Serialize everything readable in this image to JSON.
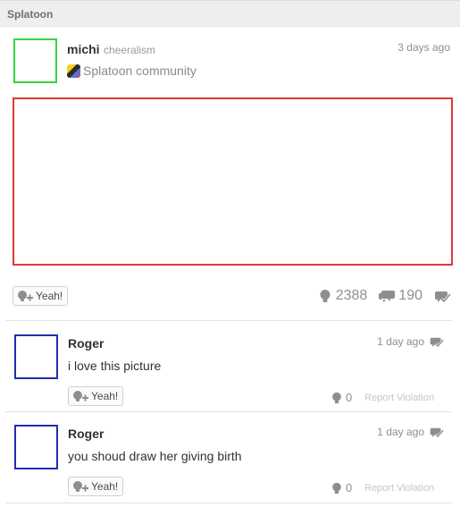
{
  "header": {
    "title": "Splatoon"
  },
  "post": {
    "username": "michi",
    "user_id": "cheeralism",
    "timestamp": "3 days ago",
    "community": "Splatoon community",
    "yeah_label": "Yeah!",
    "yeah_count": "2388",
    "comment_count": "190"
  },
  "comments": [
    {
      "username": "Roger",
      "timestamp": "1 day ago",
      "body": "i love this picture",
      "yeah_label": "Yeah!",
      "yeah_count": "0",
      "report_label": "Report Violation"
    },
    {
      "username": "Roger",
      "timestamp": "1 day ago",
      "body": "you shoud draw her giving birth",
      "yeah_label": "Yeah!",
      "yeah_count": "0",
      "report_label": "Report Violation"
    }
  ],
  "colors": {
    "post_avatar_border": "#39d43f",
    "post_image_border": "#e0383a",
    "comment_avatar_border": "#1d2fb0"
  },
  "icons": [
    "yeah-add-icon",
    "yeah-count-icon",
    "comment-count-icon",
    "spoiler-icon",
    "community-icon"
  ]
}
